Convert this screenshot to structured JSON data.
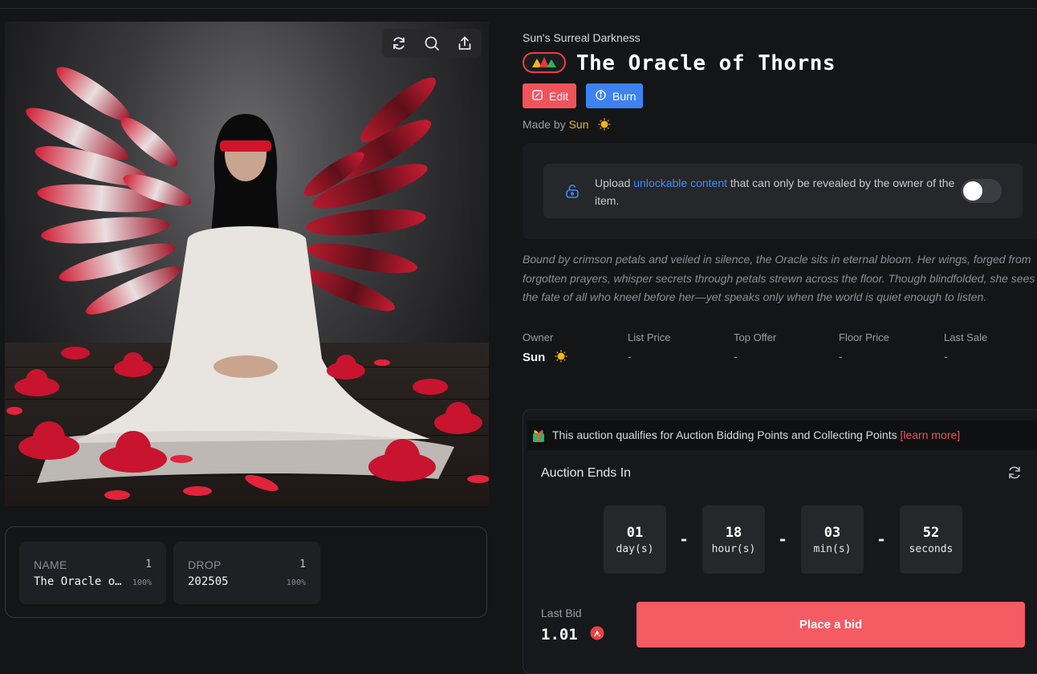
{
  "artwork": {
    "toolbar": {
      "icons": [
        "refresh-icon",
        "zoom-icon",
        "share-icon"
      ]
    }
  },
  "traits": [
    {
      "type": "NAME",
      "count": "1",
      "value": "The Oracle of Thorns",
      "value_display": "The Oracle o…",
      "percent": "100%"
    },
    {
      "type": "DROP",
      "count": "1",
      "value": "202505",
      "value_display": "202505",
      "percent": "100%"
    }
  ],
  "header": {
    "collection": "Sun's Surreal Darkness",
    "title": "The Oracle of Thorns",
    "edit_label": "Edit",
    "burn_label": "Burn",
    "made_by_prefix": "Made by",
    "creator": "Sun"
  },
  "unlockable": {
    "text_before": "Upload ",
    "link": "unlockable content",
    "text_after": " that can only be revealed by the owner of the item.",
    "toggle_on": false
  },
  "description": "Bound by crimson petals and veiled in silence, the Oracle sits in eternal bloom. Her wings, forged from forgotten prayers, whisper secrets through petals strewn across the floor. Though blindfolded, she sees the fate of all who kneel before her—yet speaks only when the world is quiet enough to listen.",
  "stats": [
    {
      "label": "Owner",
      "value": "Sun"
    },
    {
      "label": "List Price",
      "value": "-"
    },
    {
      "label": "Top Offer",
      "value": "-"
    },
    {
      "label": "Floor Price",
      "value": "-"
    },
    {
      "label": "Last Sale",
      "value": "-"
    }
  ],
  "auction": {
    "promo_text": "This auction qualifies for Auction Bidding Points and Collecting Points",
    "learn_more": "[learn more]",
    "title": "Auction Ends In",
    "countdown": [
      {
        "value": "01",
        "unit": "day(s)"
      },
      {
        "value": "18",
        "unit": "hour(s)"
      },
      {
        "value": "03",
        "unit": "min(s)"
      },
      {
        "value": "52",
        "unit": "seconds"
      }
    ],
    "separator": "-",
    "last_bid_label": "Last Bid",
    "last_bid_value": "1.01",
    "place_bid_label": "Place a bid"
  },
  "colors": {
    "accent_red": "#f45b62",
    "burn_blue": "#3d82f0",
    "link_blue": "#3d8df5",
    "creator_gold": "#f4b31f",
    "background": "#141517"
  }
}
